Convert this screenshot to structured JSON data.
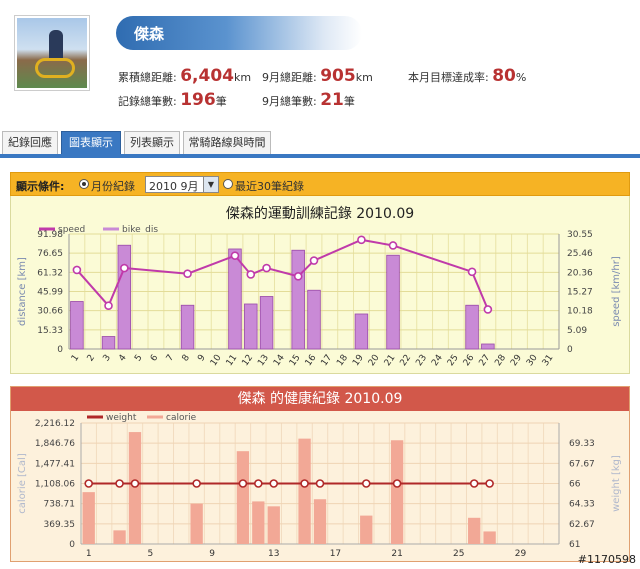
{
  "profile": {
    "name": "傑森",
    "total_distance_label": "累積總距離:",
    "total_distance": "6,404",
    "distance_unit": "km",
    "total_records_label": "記錄總筆數:",
    "total_records": "196",
    "records_unit": "筆",
    "month_distance_label": "9月總距離:",
    "month_distance": "905",
    "month_records_label": "9月總筆數:",
    "month_records": "21",
    "goal_label": "本月目標達成率:",
    "goal_value": "80",
    "goal_unit": "%"
  },
  "tabs": [
    {
      "label": "紀錄回應",
      "active": false
    },
    {
      "label": "圖表顯示",
      "active": true
    },
    {
      "label": "列表顯示",
      "active": false
    },
    {
      "label": "常騎路線與時間",
      "active": false
    }
  ],
  "filter": {
    "label": "顯示條件:",
    "option_month": "月份紀錄",
    "selected_month": "2010 9月",
    "option_recent": "最近30筆紀錄"
  },
  "chart_data": [
    {
      "type": "bar+line",
      "title": "傑森的運動訓練記錄 2010.09",
      "legend": [
        "speed",
        "bike_dis"
      ],
      "colors": {
        "speed": "#c03aaa",
        "bike_dis": "#c98ad6"
      },
      "xlabels": [
        "1",
        "2",
        "3",
        "4",
        "5",
        "6",
        "7",
        "8",
        "9",
        "10",
        "11",
        "12",
        "13",
        "14",
        "15",
        "16",
        "17",
        "18",
        "19",
        "20",
        "21",
        "22",
        "23",
        "24",
        "25",
        "26",
        "27",
        "28",
        "29",
        "30",
        "31"
      ],
      "ylabel_left": "distance [km]",
      "ylabel_right": "speed [km/hr]",
      "yticks_left": [
        "0",
        "15.33",
        "30.66",
        "45.99",
        "61.32",
        "76.65",
        "91.98"
      ],
      "yticks_right": [
        "0",
        "5.09",
        "10.18",
        "15.27",
        "20.36",
        "25.46",
        "30.55"
      ],
      "ylim_left": [
        0,
        91.98
      ],
      "ylim_right": [
        0,
        30.55
      ],
      "bars": [
        {
          "day": 1,
          "value": 38
        },
        {
          "day": 3,
          "value": 10
        },
        {
          "day": 4,
          "value": 83
        },
        {
          "day": 8,
          "value": 35
        },
        {
          "day": 11,
          "value": 80
        },
        {
          "day": 12,
          "value": 36
        },
        {
          "day": 13,
          "value": 42
        },
        {
          "day": 15,
          "value": 79
        },
        {
          "day": 16,
          "value": 47
        },
        {
          "day": 19,
          "value": 28
        },
        {
          "day": 21,
          "value": 75
        },
        {
          "day": 26,
          "value": 35
        },
        {
          "day": 27,
          "value": 4
        }
      ],
      "line": [
        {
          "day": 1,
          "value": 21.0
        },
        {
          "day": 3,
          "value": 11.5
        },
        {
          "day": 4,
          "value": 21.5
        },
        {
          "day": 8,
          "value": 20.0
        },
        {
          "day": 11,
          "value": 24.8
        },
        {
          "day": 12,
          "value": 19.8
        },
        {
          "day": 13,
          "value": 21.5
        },
        {
          "day": 15,
          "value": 19.3
        },
        {
          "day": 16,
          "value": 23.5
        },
        {
          "day": 19,
          "value": 29.0
        },
        {
          "day": 21,
          "value": 27.5
        },
        {
          "day": 26,
          "value": 20.5
        },
        {
          "day": 27,
          "value": 10.5
        }
      ]
    },
    {
      "type": "bar+line",
      "title": "傑森 的健康紀錄 2010.09",
      "legend": [
        "weight",
        "calorie"
      ],
      "colors": {
        "weight": "#b02828",
        "calorie": "#f2a896"
      },
      "xlabels": [
        "1",
        "5",
        "9",
        "13",
        "17",
        "21",
        "25",
        "29"
      ],
      "xlabel_days": [
        1,
        5,
        9,
        13,
        17,
        21,
        25,
        29
      ],
      "ylabel_left": "calorie [Cal]",
      "ylabel_right": "weight [kg]",
      "yticks_left": [
        "0",
        "369.35",
        "738.71",
        "1,108.06",
        "1,477.41",
        "1,846.76",
        "2,216.12"
      ],
      "yticks_right": [
        "61",
        "62.67",
        "64.33",
        "66",
        "67.67",
        "69.33"
      ],
      "ylim_left": [
        0,
        2216.12
      ],
      "ylim_right": [
        61,
        71
      ],
      "bars": [
        {
          "day": 1,
          "value": 950
        },
        {
          "day": 3,
          "value": 250
        },
        {
          "day": 4,
          "value": 2050
        },
        {
          "day": 8,
          "value": 740
        },
        {
          "day": 11,
          "value": 1700
        },
        {
          "day": 12,
          "value": 780
        },
        {
          "day": 13,
          "value": 690
        },
        {
          "day": 15,
          "value": 1930
        },
        {
          "day": 16,
          "value": 820
        },
        {
          "day": 19,
          "value": 520
        },
        {
          "day": 21,
          "value": 1900
        },
        {
          "day": 26,
          "value": 480
        },
        {
          "day": 27,
          "value": 230
        }
      ],
      "line": [
        {
          "day": 1,
          "value": 66
        },
        {
          "day": 3,
          "value": 66
        },
        {
          "day": 4,
          "value": 66
        },
        {
          "day": 8,
          "value": 66
        },
        {
          "day": 11,
          "value": 66
        },
        {
          "day": 12,
          "value": 66
        },
        {
          "day": 13,
          "value": 66
        },
        {
          "day": 15,
          "value": 66
        },
        {
          "day": 16,
          "value": 66
        },
        {
          "day": 19,
          "value": 66
        },
        {
          "day": 21,
          "value": 66
        },
        {
          "day": 26,
          "value": 66
        },
        {
          "day": 27,
          "value": 66
        }
      ]
    }
  ],
  "watermark": "#1170598"
}
